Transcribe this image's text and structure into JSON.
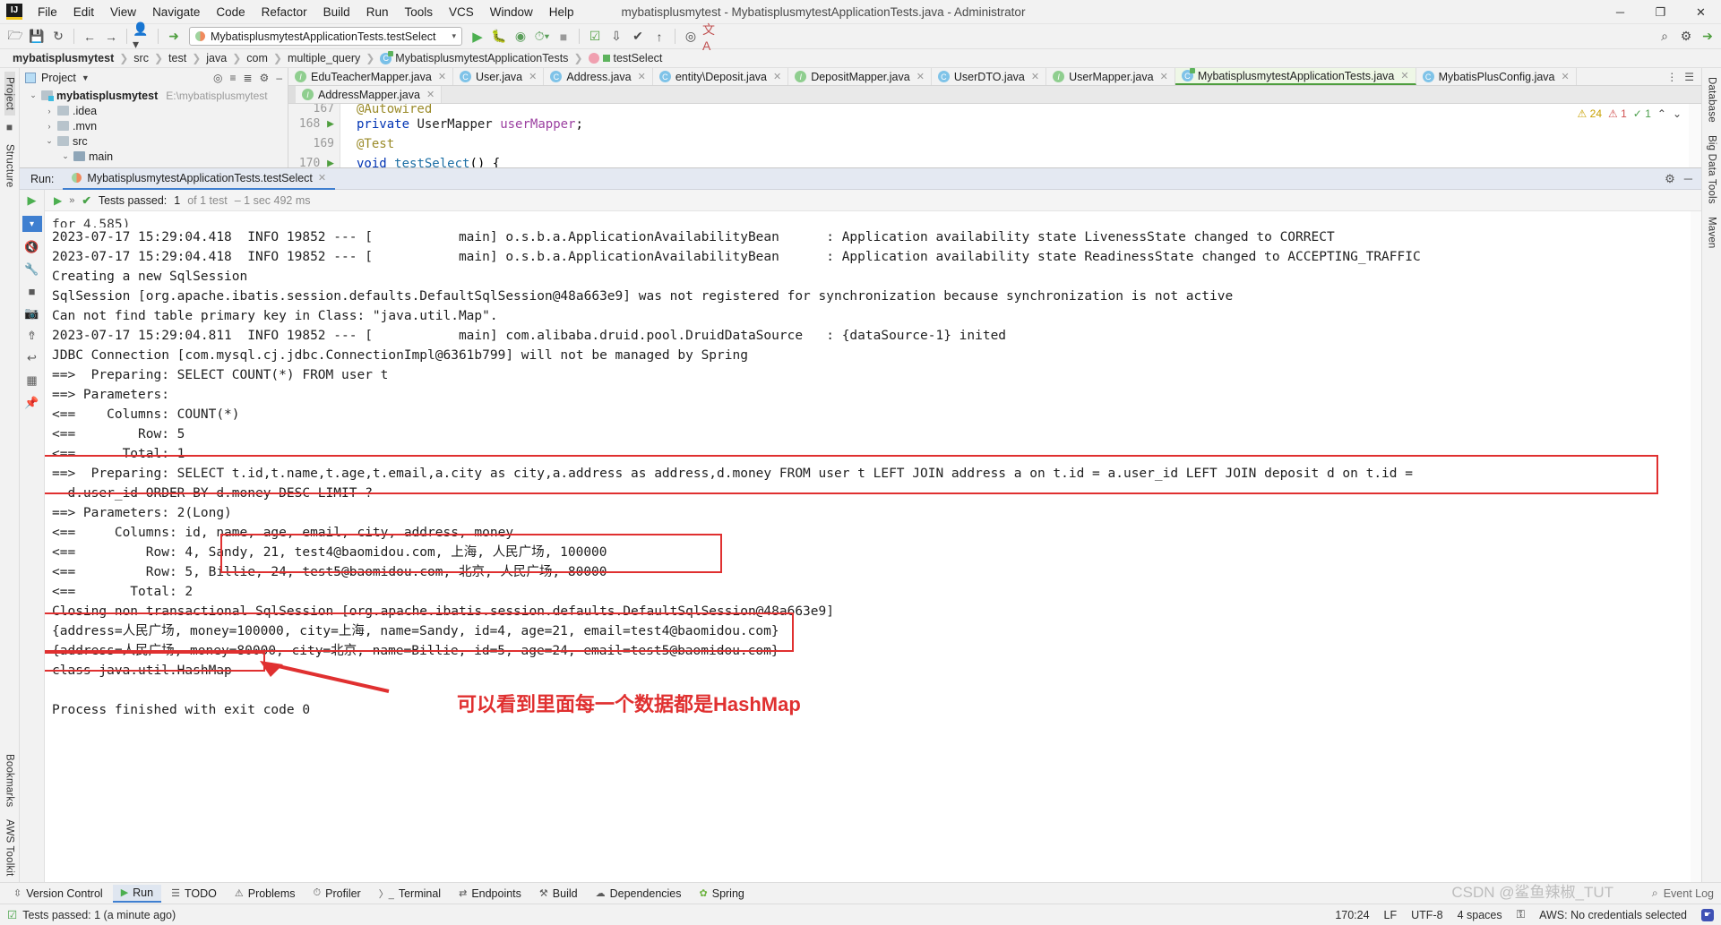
{
  "titlebar": {
    "logo": "IJ",
    "window_title": "mybatisplusmytest - MybatisplusmytestApplicationTests.java - Administrator",
    "menu": [
      "File",
      "Edit",
      "View",
      "Navigate",
      "Code",
      "Refactor",
      "Build",
      "Run",
      "Tools",
      "VCS",
      "Window",
      "Help"
    ],
    "minimize": "─",
    "maximize": "❐",
    "close": "✕"
  },
  "toolbar": {
    "open_icon": "folder-open-icon",
    "save_icon": "save-icon",
    "sync_icon": "sync-icon",
    "back_icon": "←",
    "forward_icon": "→",
    "profile_icon": "⚇",
    "build_icon": "⚒",
    "run_config": "MybatisplusmytestApplicationTests.testSelect",
    "run_icon": "▶",
    "debug_icon": "debug-icon",
    "coverage_icon": "coverage-icon",
    "profiler_icon": "profiler-icon",
    "stop_icon": "■",
    "search_icon": "⌕",
    "settings_icon": "⚙",
    "translate_icon": "文A"
  },
  "breadcrumb": {
    "items": [
      {
        "label": "mybatisplusmytest",
        "icon": "none"
      },
      {
        "label": "src",
        "icon": "none"
      },
      {
        "label": "test",
        "icon": "none"
      },
      {
        "label": "java",
        "icon": "none"
      },
      {
        "label": "com",
        "icon": "none"
      },
      {
        "label": "multiple_query",
        "icon": "none"
      },
      {
        "label": "MybatisplusmytestApplicationTests",
        "icon": "test-class-icon"
      },
      {
        "label": "testSelect",
        "icon": "test-method-icon"
      }
    ]
  },
  "project_panel": {
    "title": "Project",
    "caret": "▼",
    "tools": [
      "target-icon",
      "collapse-all-icon",
      "expand-icon",
      "settings-icon",
      "minimize-icon"
    ],
    "tree": [
      {
        "label": "mybatisplusmytest",
        "path": "E:\\mybatisplusmytest",
        "arrow": "⌄",
        "depth": 0,
        "bold": true,
        "kind": "module"
      },
      {
        "label": ".idea",
        "path": "",
        "arrow": "›",
        "depth": 1,
        "bold": false,
        "kind": "folder"
      },
      {
        "label": ".mvn",
        "path": "",
        "arrow": "›",
        "depth": 1,
        "bold": false,
        "kind": "folder"
      },
      {
        "label": "src",
        "path": "",
        "arrow": "⌄",
        "depth": 1,
        "bold": false,
        "kind": "folder"
      },
      {
        "label": "main",
        "path": "",
        "arrow": "⌄",
        "depth": 2,
        "bold": false,
        "kind": "src"
      }
    ],
    "side_labels": [
      "Project",
      "Structure",
      "Bookmarks",
      "AWS Toolkit"
    ]
  },
  "editor_tabs": {
    "row1": [
      {
        "label": "EduTeacherMapper.java",
        "icon": "interface-icon",
        "active": false
      },
      {
        "label": "User.java",
        "icon": "class-icon",
        "active": false
      },
      {
        "label": "Address.java",
        "icon": "class-icon",
        "active": false
      },
      {
        "label": "entity\\Deposit.java",
        "icon": "class-icon",
        "active": false
      },
      {
        "label": "DepositMapper.java",
        "icon": "interface-icon",
        "active": false
      },
      {
        "label": "UserDTO.java",
        "icon": "class-icon",
        "active": false
      },
      {
        "label": "UserMapper.java",
        "icon": "interface-icon",
        "active": false
      },
      {
        "label": "MybatisplusmytestApplicationTests.java",
        "icon": "test-class-icon",
        "active": true
      },
      {
        "label": "MybatisPlusConfig.java",
        "icon": "class-icon",
        "active": false
      }
    ],
    "row2": [
      {
        "label": "AddressMapper.java",
        "icon": "interface-icon",
        "active": false
      }
    ],
    "overflow_icon": "⋮",
    "list_icon": "☰"
  },
  "code": {
    "lines": [
      {
        "num": "167",
        "text": "@Autowired",
        "marker": ""
      },
      {
        "num": "168",
        "text": "private UserMapper userMapper;",
        "marker": "run-gutter-icon"
      },
      {
        "num": "169",
        "text": "@Test",
        "marker": ""
      },
      {
        "num": "170",
        "text": "void testSelect() {",
        "marker": "run-gutter-icon"
      }
    ],
    "inspection": {
      "warnings": "24",
      "errors": "1",
      "weak": "1",
      "ok": "✓"
    }
  },
  "run_panel": {
    "label": "Run:",
    "tab_title": "MybatisplusmytestApplicationTests.testSelect",
    "close_icon": "✕",
    "settings_icon": "⚙",
    "minimize_icon": "─",
    "rail_icons": [
      "run-icon",
      "mute-breakpoints-icon",
      "wrench-icon",
      "stop-icon",
      "camera-icon",
      "export-icon",
      "print-icon",
      "trash-icon",
      "pin-icon"
    ],
    "tests_status": {
      "chevron": "»",
      "tick": "✔",
      "label": "Tests passed:",
      "count": "1",
      "of_text": "of 1 test",
      "duration": "– 1 sec 492 ms"
    },
    "console_lines": [
      "for 4.585)",
      "2023-07-17 15:29:04.418  INFO 19852 --- [           main] o.s.b.a.ApplicationAvailabilityBean      : Application availability state LivenessState changed to CORRECT",
      "2023-07-17 15:29:04.418  INFO 19852 --- [           main] o.s.b.a.ApplicationAvailabilityBean      : Application availability state ReadinessState changed to ACCEPTING_TRAFFIC",
      "Creating a new SqlSession",
      "SqlSession [org.apache.ibatis.session.defaults.DefaultSqlSession@48a663e9] was not registered for synchronization because synchronization is not active",
      "Can not find table primary key in Class: \"java.util.Map\".",
      "2023-07-17 15:29:04.811  INFO 19852 --- [           main] com.alibaba.druid.pool.DruidDataSource   : {dataSource-1} inited",
      "JDBC Connection [com.mysql.cj.jdbc.ConnectionImpl@6361b799] will not be managed by Spring",
      "==>  Preparing: SELECT COUNT(*) FROM user t",
      "==> Parameters: ",
      "<==    Columns: COUNT(*)",
      "<==        Row: 5",
      "<==      Total: 1",
      "==>  Preparing: SELECT t.id,t.name,t.age,t.email,a.city as city,a.address as address,d.money FROM user t LEFT JOIN address a on t.id = a.user_id LEFT JOIN deposit d on t.id =",
      "  d.user_id ORDER BY d.money DESC LIMIT ?",
      "==> Parameters: 2(Long)",
      "<==     Columns: id, name, age, email, city, address, money",
      "<==         Row: 4, Sandy, 21, test4@baomidou.com, 上海, 人民广场, 100000",
      "<==         Row: 5, Billie, 24, test5@baomidou.com, 北京, 人民广场, 80000",
      "<==       Total: 2",
      "Closing non transactional SqlSession [org.apache.ibatis.session.defaults.DefaultSqlSession@48a663e9]",
      "{address=人民广场, money=100000, city=上海, name=Sandy, id=4, age=21, email=test4@baomidou.com}",
      "{address=人民广场, money=80000, city=北京, name=Billie, id=5, age=24, email=test5@baomidou.com}",
      "class java.util.HashMap",
      "",
      "Process finished with exit code 0"
    ],
    "annotation": "可以看到里面每一个数据都是HashMap"
  },
  "toolwindow_bar": {
    "items": [
      {
        "label": "Version Control",
        "icon": "branch-icon",
        "active": false
      },
      {
        "label": "Run",
        "icon": "run-icon",
        "active": true
      },
      {
        "label": "TODO",
        "icon": "todo-icon",
        "active": false
      },
      {
        "label": "Problems",
        "icon": "problems-icon",
        "active": false
      },
      {
        "label": "Profiler",
        "icon": "profiler-icon",
        "active": false
      },
      {
        "label": "Terminal",
        "icon": "terminal-icon",
        "active": false
      },
      {
        "label": "Endpoints",
        "icon": "endpoints-icon",
        "active": false
      },
      {
        "label": "Build",
        "icon": "build-icon",
        "active": false
      },
      {
        "label": "Dependencies",
        "icon": "dependencies-icon",
        "active": false
      },
      {
        "label": "Spring",
        "icon": "spring-icon",
        "active": false
      }
    ],
    "event_log": "Event Log",
    "event_log_icon": "⌕"
  },
  "statusbar": {
    "message": "Tests passed: 1 (a minute ago)",
    "caret_position": "170:24",
    "line_separator": "LF",
    "encoding": "UTF-8",
    "indent": "4 spaces",
    "lock_icon": "⚿",
    "aws": "AWS: No credentials selected",
    "paw_icon": "🐾"
  },
  "watermark": "CSDN @鲨鱼辣椒_TUT",
  "right_rail": {
    "labels": [
      "Database",
      "Big Data Tools",
      "Maven"
    ]
  },
  "colors": {
    "accent_blue": "#3f7fd0",
    "run_green": "#4caf50",
    "highlight_red": "#e03030",
    "tab_active_bg": "#eef7e6"
  }
}
